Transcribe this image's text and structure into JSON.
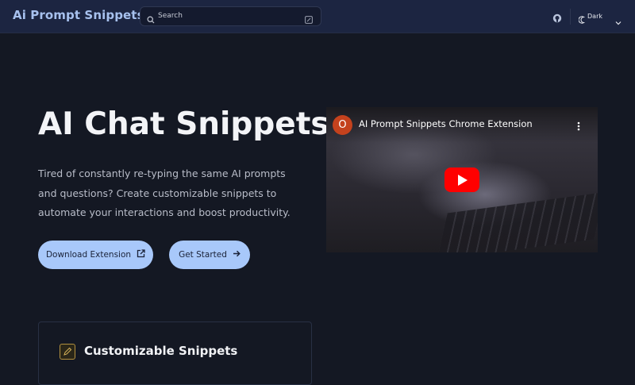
{
  "navbar": {
    "brand": "Ai Prompt Snippets",
    "search": {
      "placeholder": "Search",
      "icon": "search-icon",
      "shortcut_icon": "keyboard-shortcut-icon"
    },
    "github_icon": "github-icon",
    "theme": {
      "label": "Dark",
      "icon": "moon-icon",
      "dropdown_icon": "chevron-down-icon"
    }
  },
  "hero": {
    "title": "AI Chat Snippets",
    "description": "Tired of constantly re-typing the same AI prompts and questions? Create customizable snippets to automate your interactions and boost productivity.",
    "buttons": {
      "download": "Download Extension",
      "get_started": "Get Started"
    }
  },
  "video": {
    "channel_initial": "O",
    "title": "AI Prompt Snippets Chrome Extension"
  },
  "feature_card": {
    "title": "Customizable Snippets",
    "icon": "pencil-icon"
  },
  "colors": {
    "background": "#141823",
    "navbar": "#1c2541",
    "brand": "#a7c1ee",
    "button": "#a8c8fa",
    "youtube_red": "#ff0000"
  }
}
